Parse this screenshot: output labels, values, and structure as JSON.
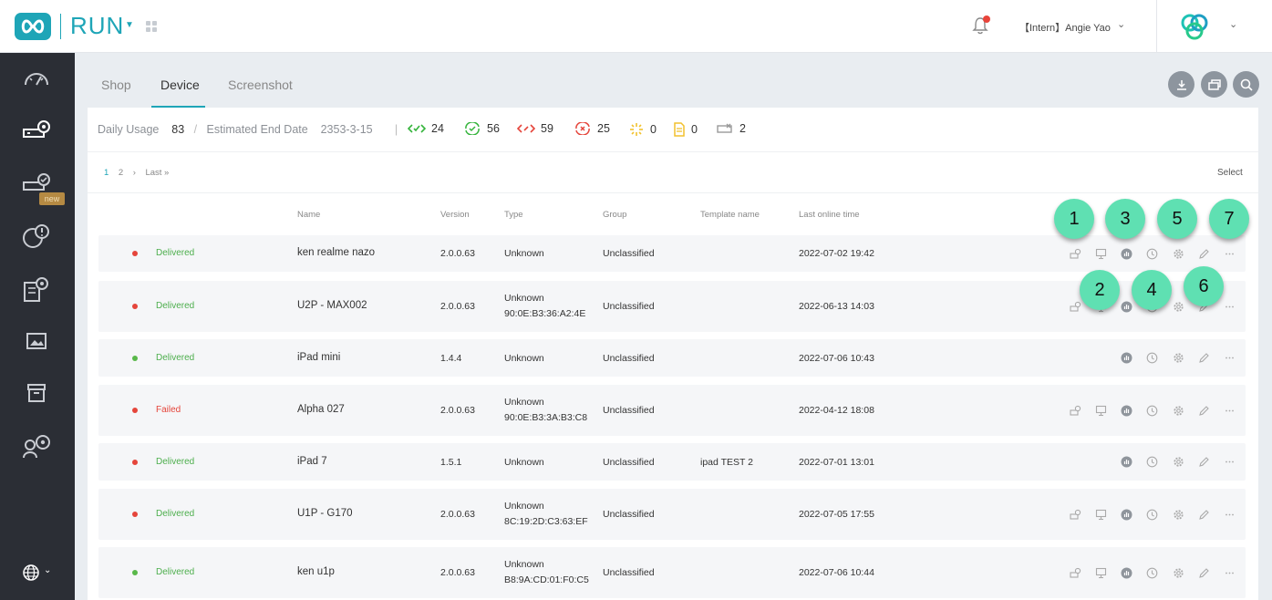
{
  "header": {
    "app_title": "RUN",
    "user_name": "【Intern】Angie Yao"
  },
  "tabs": [
    {
      "label": "Shop"
    },
    {
      "label": "Device"
    },
    {
      "label": "Screenshot"
    }
  ],
  "stats": {
    "daily_usage_label": "Daily Usage",
    "daily_usage_value": "83",
    "slash": "/",
    "end_date_label": "Estimated End Date",
    "end_date_value": "2353-3-15",
    "divider": "|",
    "counts": [
      {
        "icon": "online-code-icon",
        "value": "24",
        "color": "#35b43c"
      },
      {
        "icon": "sync-check-icon",
        "value": "56",
        "color": "#35b43c"
      },
      {
        "icon": "offline-code-icon",
        "value": "59",
        "color": "#e5453b"
      },
      {
        "icon": "error-x-icon",
        "value": "25",
        "color": "#e5453b"
      },
      {
        "icon": "loading-icon",
        "value": "0",
        "color": "#f2c12e"
      },
      {
        "icon": "document-icon",
        "value": "0",
        "color": "#f2c12e"
      },
      {
        "icon": "disconnected-icon",
        "value": "2",
        "color": "#999999"
      }
    ]
  },
  "pager": {
    "page1": "1",
    "page2": "2",
    "next": "›",
    "last": "Last »"
  },
  "select_label": "Select",
  "columns": {
    "name": "Name",
    "version": "Version",
    "type": "Type",
    "group": "Group",
    "template": "Template name",
    "last_online": "Last online time"
  },
  "rows": [
    {
      "status_color": "#e5453b",
      "status": "Delivered",
      "status_text_color": "#4cae4c",
      "name": "ken realme nazo",
      "version": "2.0.0.63",
      "type": "Unknown",
      "mac": "",
      "group": "Unclassified",
      "template": "",
      "last_online": "2022-07-02 19:42"
    },
    {
      "status_color": "#e5453b",
      "status": "Delivered",
      "status_text_color": "#4cae4c",
      "name": "U2P - MAX002",
      "version": "2.0.0.63",
      "type": "Unknown",
      "mac": "90:0E:B3:36:A2:4E",
      "group": "Unclassified",
      "template": "",
      "last_online": "2022-06-13 14:03"
    },
    {
      "status_color": "#59b84a",
      "status": "Delivered",
      "status_text_color": "#4cae4c",
      "name": "iPad mini",
      "version": "1.4.4",
      "type": "Unknown",
      "mac": "",
      "group": "Unclassified",
      "template": "",
      "last_online": "2022-07-06 10:43"
    },
    {
      "status_color": "#e5453b",
      "status": "Failed",
      "status_text_color": "#e5453b",
      "name": "Alpha 027",
      "version": "2.0.0.63",
      "type": "Unknown",
      "mac": "90:0E:B3:3A:B3:C8",
      "group": "Unclassified",
      "template": "",
      "last_online": "2022-04-12 18:08"
    },
    {
      "status_color": "#e5453b",
      "status": "Delivered",
      "status_text_color": "#4cae4c",
      "name": "iPad 7",
      "version": "1.5.1",
      "type": "Unknown",
      "mac": "",
      "group": "Unclassified",
      "template": "ipad TEST 2",
      "last_online": "2022-07-01 13:01"
    },
    {
      "status_color": "#e5453b",
      "status": "Delivered",
      "status_text_color": "#4cae4c",
      "name": "U1P - G170",
      "version": "2.0.0.63",
      "type": "Unknown",
      "mac": "8C:19:2D:C3:63:EF",
      "group": "Unclassified",
      "template": "",
      "last_online": "2022-07-05 17:55"
    },
    {
      "status_color": "#59b84a",
      "status": "Delivered",
      "status_text_color": "#4cae4c",
      "name": "ken u1p",
      "version": "2.0.0.63",
      "type": "Unknown",
      "mac": "B8:9A:CD:01:F0:C5",
      "group": "Unclassified",
      "template": "",
      "last_online": "2022-07-06 10:44"
    }
  ],
  "sidebar": {
    "new_badge": "new"
  },
  "callouts": [
    "1",
    "2",
    "3",
    "4",
    "5",
    "6",
    "7"
  ]
}
